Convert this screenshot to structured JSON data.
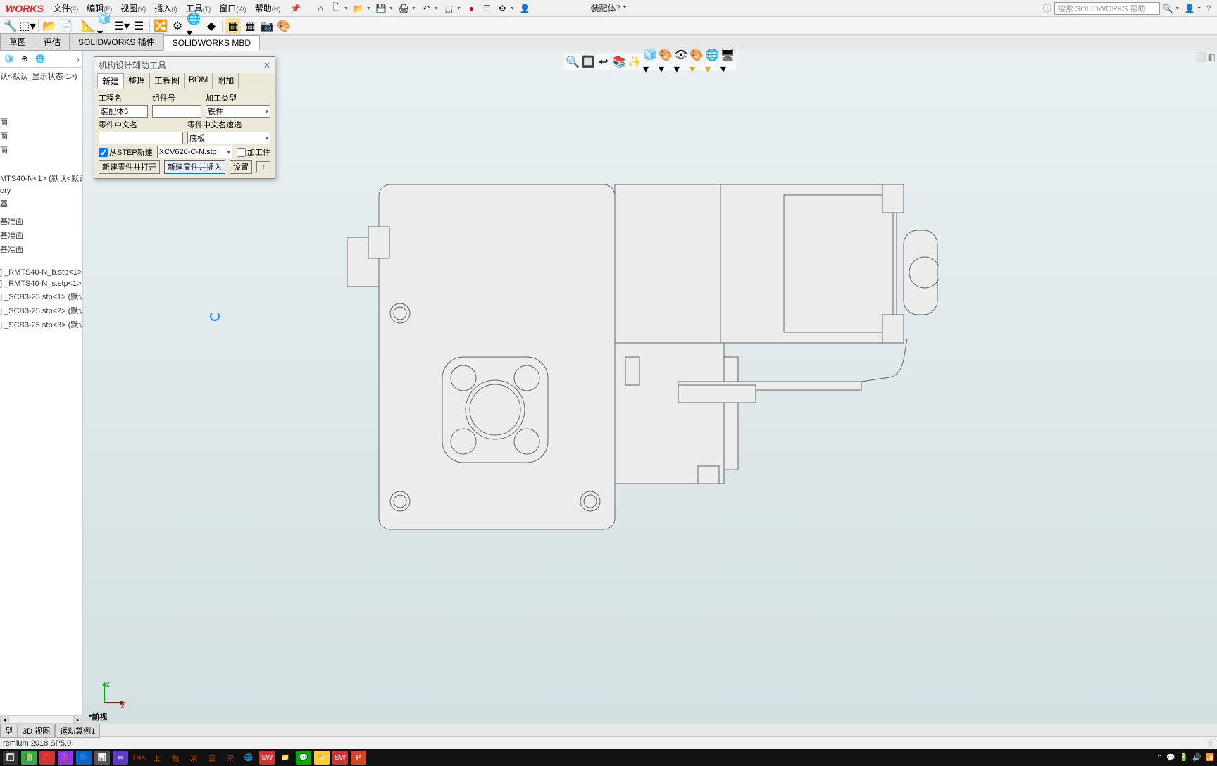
{
  "app": {
    "logo": "WORKS",
    "title": "装配体7 *"
  },
  "menu": {
    "file": "文件",
    "file_key": "(F)",
    "edit": "编辑",
    "edit_key": "(E)",
    "view": "视图",
    "view_key": "(V)",
    "insert": "插入",
    "insert_key": "(I)",
    "tools": "工具",
    "tools_key": "(T)",
    "window": "窗口",
    "window_key": "(W)",
    "help": "帮助",
    "help_key": "(H)"
  },
  "search": {
    "placeholder": "搜索 SOLIDWORKS 帮助"
  },
  "cm_tabs": {
    "sketch": "草图",
    "evaluate": "评估",
    "addins": "SOLIDWORKS 插件",
    "mbd": "SOLIDWORKS MBD"
  },
  "feature_tree": {
    "config": "认<默认_显示状态-1>)",
    "items": [
      "面",
      "面",
      "面",
      "MTS40-N<1> (默认<默认",
      "ory",
      "器",
      "基准面",
      "基准面",
      "基准面",
      "] _RMTS40-N_b.stp<1>",
      "] _RMTS40-N_s.stp<1> (",
      "] _SCB3-25.stp<1> (默认",
      "] _SCB3-25.stp<2> (默认",
      "] _SCB3-25.stp<3> (默认"
    ]
  },
  "dialog": {
    "title": "机构设计辅助工具",
    "tabs": {
      "new": "新建",
      "arrange": "整理",
      "drawing": "工程图",
      "bom": "BOM",
      "attach": "附加"
    },
    "lbl_project": "工程名",
    "val_project": "装配体5",
    "lbl_component": "组件号",
    "lbl_proctype": "加工类型",
    "val_proctype": "铁件",
    "lbl_partname": "零件中文名",
    "lbl_partquick": "零件中文名速选",
    "val_partquick": "底板",
    "chk_fromstep": "从STEP新建",
    "val_step": "XCV620-C-N.stp",
    "chk_workpiece": "加工件",
    "btn_newopen": "新建零件并打开",
    "btn_newinsert": "新建零件并插入",
    "btn_settings": "设置",
    "btn_up": "↑"
  },
  "triad": {
    "x": "X",
    "z": "Z"
  },
  "view_label": "*前视",
  "bottom_tabs": {
    "model": "型",
    "view3d": "3D 视图",
    "motion": "运动算例1"
  },
  "statusbar": {
    "version": "remium 2018 SP5.0"
  },
  "icons": {
    "home": "⌂",
    "new": "🗋",
    "open": "📂",
    "save": "💾",
    "print": "🖨",
    "undo": "↶",
    "select": "⬚",
    "rebuild": "🔄",
    "options": "⚙",
    "user": "👤",
    "help_q": "?",
    "help_circle": "?",
    "search_mag": "🔍",
    "user2": "👤",
    "notif": "🔔",
    "magnify": "🔍",
    "rotate": "🔄",
    "fit": "⛶",
    "section": "✂",
    "display": "🎨",
    "hide": "👁",
    "appearance": "🎨",
    "render": "🌐",
    "scene": "🖥",
    "fp1": "🧊",
    "fp2": "⊕",
    "fp3": "🌐"
  }
}
